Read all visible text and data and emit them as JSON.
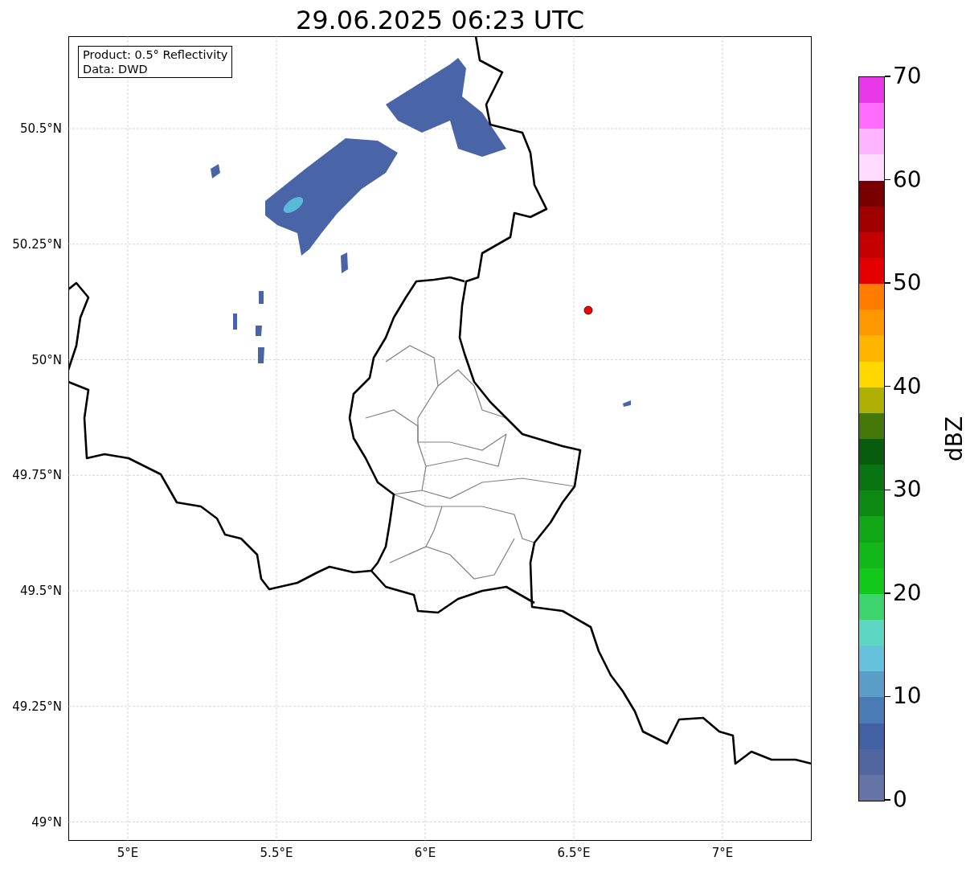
{
  "title": "29.06.2025 06:23 UTC",
  "info_box": [
    "Product: 0.5° Reflectivity",
    "Data: DWD"
  ],
  "y_ticks": [
    "50.5°N",
    "50.25°N",
    "50°N",
    "49.75°N",
    "49.5°N",
    "49.25°N",
    "49°N"
  ],
  "x_ticks": [
    "5°E",
    "5.5°E",
    "6°E",
    "6.5°E",
    "7°E"
  ],
  "colorbar": {
    "label": "dBZ",
    "ticks": [
      "70",
      "60",
      "50",
      "40",
      "30",
      "20",
      "10",
      "0"
    ],
    "bands": [
      {
        "color": "#e838e8"
      },
      {
        "color": "#ff6cff"
      },
      {
        "color": "#ffb4ff"
      },
      {
        "color": "#ffdcff"
      },
      {
        "color": "#7a0000"
      },
      {
        "color": "#a00000"
      },
      {
        "color": "#c40000"
      },
      {
        "color": "#e40000"
      },
      {
        "color": "#ff7c00"
      },
      {
        "color": "#ff9800"
      },
      {
        "color": "#ffb400"
      },
      {
        "color": "#ffd800"
      },
      {
        "color": "#b0b004"
      },
      {
        "color": "#447808"
      },
      {
        "color": "#075c0e"
      },
      {
        "color": "#0b7412"
      },
      {
        "color": "#0e8a14"
      },
      {
        "color": "#10a616"
      },
      {
        "color": "#12b81a"
      },
      {
        "color": "#12c81a"
      },
      {
        "color": "#3dd46e"
      },
      {
        "color": "#5ed6c4"
      },
      {
        "color": "#66c2dc"
      },
      {
        "color": "#5a9ec8"
      },
      {
        "color": "#4b7bb4"
      },
      {
        "color": "#4260a2"
      },
      {
        "color": "#5166a0"
      },
      {
        "color": "#6574a7"
      }
    ]
  }
}
